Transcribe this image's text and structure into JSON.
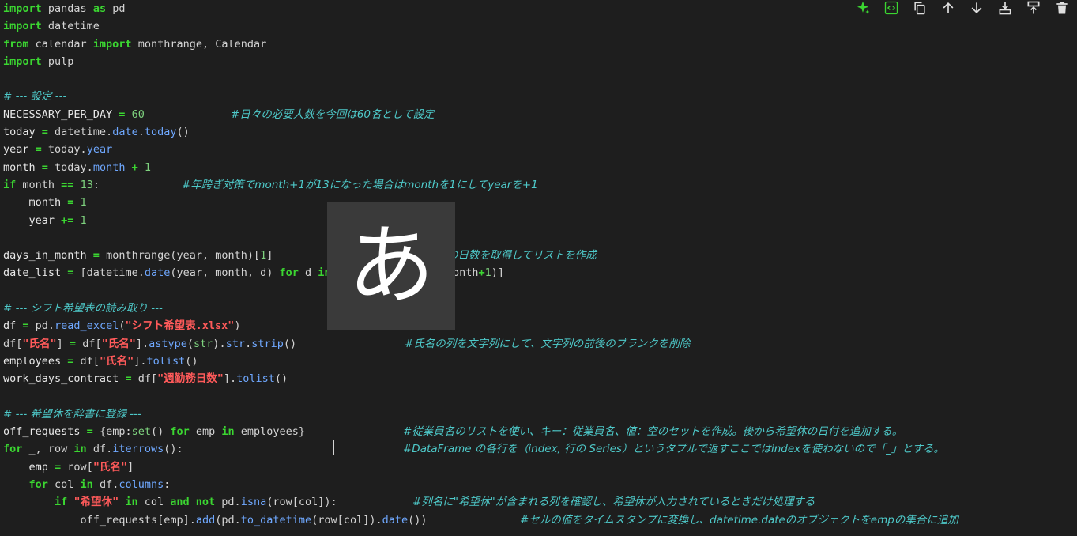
{
  "toolbar": {
    "buttons": [
      {
        "icon": "sparkle-icon"
      },
      {
        "icon": "code-icon"
      },
      {
        "icon": "copy-icon"
      },
      {
        "icon": "arrow-up-icon"
      },
      {
        "icon": "arrow-down-icon"
      },
      {
        "icon": "add-cell-below-icon"
      },
      {
        "icon": "add-cell-above-icon"
      },
      {
        "icon": "trash-icon"
      }
    ]
  },
  "ime_overlay": {
    "char": "あ"
  },
  "code": {
    "l1": {
      "k1": "import",
      "t1": " pandas ",
      "k2": "as",
      "t2": " pd"
    },
    "l2": {
      "k1": "import",
      "t1": " datetime"
    },
    "l3": {
      "k1": "from",
      "t1": " calendar ",
      "k2": "import",
      "t2": " monthrange, Calendar"
    },
    "l4": {
      "k1": "import",
      "t1": " pulp"
    },
    "l6": {
      "c": "# --- 設定 ---"
    },
    "l7": {
      "v": "NECESSARY_PER_DAY",
      "o": " = ",
      "n": "60",
      "c": "#日々の必要人数を今回は60名として設定"
    },
    "l8": {
      "v": "today",
      "o": " = ",
      "t1": "datetime.",
      "a1": "date",
      "t2": ".",
      "a2": "today",
      "t3": "()"
    },
    "l9": {
      "v": "year",
      "o": " = ",
      "t1": "today.",
      "a1": "year"
    },
    "l10": {
      "v": "month",
      "o": " = ",
      "t1": "today.",
      "a1": "month",
      "o2": " + ",
      "n": "1"
    },
    "l11": {
      "k": "if",
      "t1": " month ",
      "o": "==",
      "t2": " ",
      "n": "13",
      "t3": ":",
      "c": "#年跨ぎ対策でmonth+1が13になった場合はmonthを1にしてyearを+1"
    },
    "l12": {
      "v": "month",
      "o": " = ",
      "n": "1"
    },
    "l13": {
      "v": "year",
      "o": " += ",
      "n": "1"
    },
    "l15": {
      "v": "days_in_month",
      "o": " = ",
      "t1": "monthrange(year, month)",
      "t2": "[",
      "n": "1",
      "t3": "]",
      "c": "ト対象月の日数を取得してリストを作成"
    },
    "l16": {
      "v": "date_list",
      "o": " = ",
      "t1": "[datetime.",
      "a1": "date",
      "t2": "(year, month, d) ",
      "k1": "for",
      "t3": " d ",
      "k2": "in",
      "t4": "      (1, days_in_month",
      "o2": "+",
      "n": "1",
      "t5": ")]"
    },
    "l18": {
      "c": "# --- シフト希望表の読み取り ---"
    },
    "l19": {
      "v": "df",
      "o": " = ",
      "t1": "pd.",
      "a1": "read_excel",
      "t2": "(",
      "s": "\"シフト希望表.xlsx\"",
      "t3": ")"
    },
    "l20": {
      "t1": "df[",
      "s1": "\"氏名\"",
      "t2": "] ",
      "o": "=",
      "t3": " df[",
      "s2": "\"氏名\"",
      "t4": "].",
      "a1": "astype",
      "t5": "(",
      "f": "str",
      "t6": ").",
      "a2": "str",
      "t7": ".",
      "a3": "strip",
      "t8": "()",
      "c": "#氏名の列を文字列にして、文字列の前後のブランクを削除"
    },
    "l21": {
      "v": "employees",
      "o": " = ",
      "t1": "df[",
      "s": "\"氏名\"",
      "t2": "].",
      "a1": "tolist",
      "t3": "()"
    },
    "l22": {
      "v": "work_days_contract",
      "o": " = ",
      "t1": "df[",
      "s": "\"週勤務日数\"",
      "t2": "].",
      "a1": "tolist",
      "t3": "()"
    },
    "l24": {
      "c": "# --- 希望休を辞書に登録 ---"
    },
    "l25": {
      "v": "off_requests",
      "o": " = ",
      "t1": "{emp:",
      "f": "set",
      "t2": "() ",
      "k1": "for",
      "t3": " emp ",
      "k2": "in",
      "t4": " employees}",
      "c": "#従業員名のリストを使い、キー：従業員名、値：空のセットを作成。後から希望休の日付を追加する。"
    },
    "l26": {
      "k1": "for",
      "t1": " _, row ",
      "k2": "in",
      "t2": " df.",
      "a1": "iterrows",
      "t3": "():",
      "c": "#DataFrame の各行を（index, 行の Series）というタプルで返すここではindexを使わないので「_」とする。"
    },
    "l27": {
      "v": "emp",
      "o": " = ",
      "t1": "row[",
      "s": "\"氏名\"",
      "t2": "]"
    },
    "l28": {
      "k1": "for",
      "t1": " col ",
      "k2": "in",
      "t2": " df.",
      "a1": "columns",
      "t3": ":"
    },
    "l29": {
      "k1": "if",
      "t1": " ",
      "s": "\"希望休\"",
      "t2": " ",
      "k2": "in",
      "t3": " col ",
      "k3": "and",
      "t4": " ",
      "k4": "not",
      "t5": " pd.",
      "a1": "isna",
      "t6": "(row[col]):",
      "c": "#列名に\"希望休\"が含まれる列を確認し、希望休が入力されているときだけ処理する"
    },
    "l30": {
      "t1": "off_requests[emp].",
      "a1": "add",
      "t2": "(pd.",
      "a2": "to_datetime",
      "t3": "(row[col]).",
      "a3": "date",
      "t4": "())",
      "c": "#セルの値をタイムスタンプに変換し、datetime.dateのオブジェクトをempの集合に追加"
    }
  }
}
